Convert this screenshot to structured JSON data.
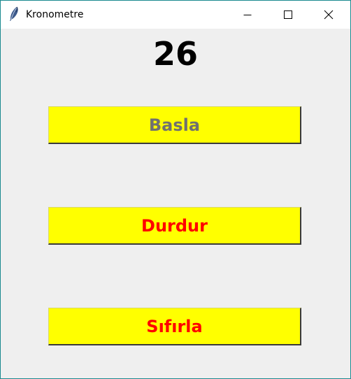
{
  "window": {
    "title": "Kronometre",
    "icon": "feather-icon",
    "border_color": "#1b8a8f"
  },
  "titlebar_controls": {
    "minimize_icon": "minimize-icon",
    "maximize_icon": "maximize-icon",
    "close_icon": "close-icon"
  },
  "counter": {
    "value": "26"
  },
  "buttons": {
    "start": {
      "label": "Basla",
      "text_color": "#707070",
      "state": "disabled"
    },
    "stop": {
      "label": "Durdur",
      "text_color": "#ff0000"
    },
    "reset": {
      "label": "Sıfırla",
      "text_color": "#ff0000"
    },
    "background_color": "#ffff00"
  }
}
